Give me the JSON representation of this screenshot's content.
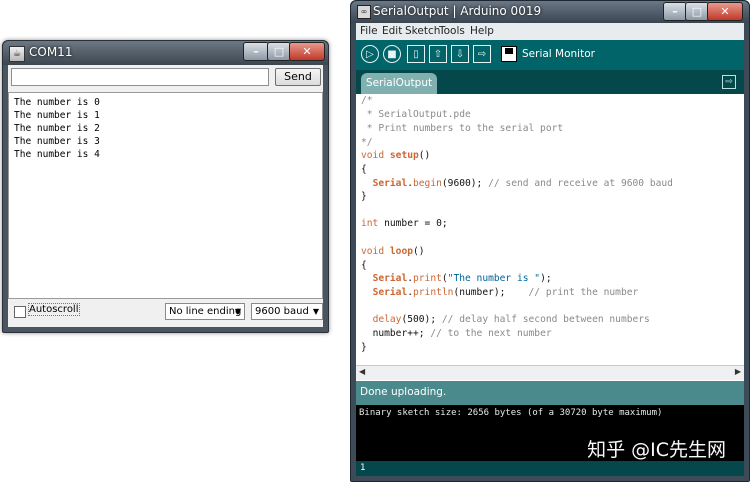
{
  "serial_window": {
    "title": "COM11",
    "input_value": "",
    "send_label": "Send",
    "output_lines": [
      "The number is 0",
      "The number is 1",
      "The number is 2",
      "The number is 3",
      "The number is 4"
    ],
    "autoscroll_label": "Autoscroll",
    "autoscroll_checked": false,
    "line_ending": "No line ending",
    "baud": "9600 baud"
  },
  "arduino_window": {
    "title": "SerialOutput | Arduino 0019",
    "menu": [
      "File",
      "Edit",
      "Sketch",
      "Tools",
      "Help"
    ],
    "toolbar": {
      "serial_monitor_label": "Serial Monitor"
    },
    "tab_label": "SerialOutput",
    "code": {
      "l1": "/*",
      "l2": " * SerialOutput.pde",
      "l3": " * Print numbers to the serial port",
      "l4": "*/",
      "setup_kw": "void",
      "setup_fn": "setup",
      "setup_rest": "()",
      "brace_open": "{",
      "serial_cls": "Serial",
      "begin_fn": "begin",
      "begin_args": "(9600); ",
      "begin_comment": "// send and receive at 9600 baud",
      "brace_close": "}",
      "int_kw": "int",
      "int_rest": " number = 0;",
      "loop_kw": "void",
      "loop_fn": "loop",
      "loop_rest": "()",
      "print_fn": "print",
      "print_open": "(",
      "print_str": "\"The number is \"",
      "print_close": ");",
      "println_fn": "println",
      "println_args": "(number);    ",
      "println_comment": "// print the number",
      "delay_fn": "delay",
      "delay_args": "(500); ",
      "delay_comment": "// delay half second between numbers",
      "incr": "number++; ",
      "incr_comment": "// to the next number"
    },
    "status": "Done uploading.",
    "console": "Binary sketch size: 2656 bytes (of a 30720 byte maximum)",
    "watermark": "知乎 @IC先生网",
    "line_number": "1"
  }
}
